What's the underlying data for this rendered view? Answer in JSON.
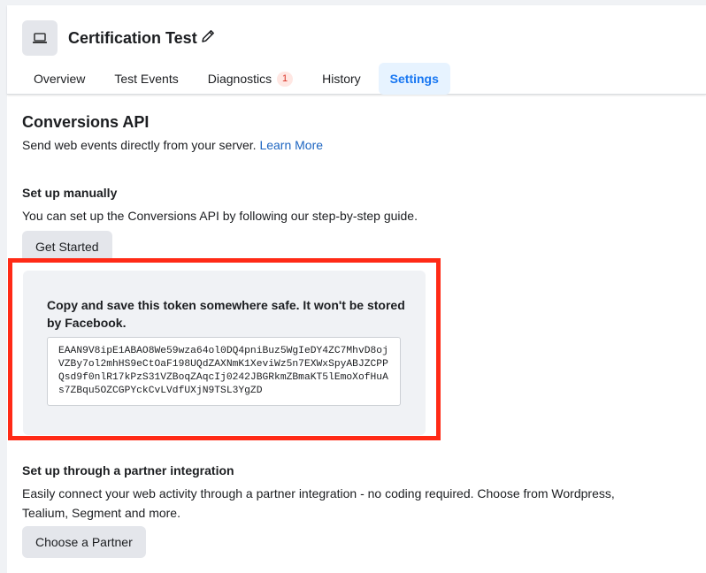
{
  "header": {
    "title": "Certification Test",
    "icons": {
      "app": "laptop-icon",
      "edit": "pencil-icon"
    }
  },
  "tabs": [
    {
      "label": "Overview"
    },
    {
      "label": "Test Events"
    },
    {
      "label": "Diagnostics",
      "badge": "1"
    },
    {
      "label": "History"
    },
    {
      "label": "Settings",
      "active": true
    }
  ],
  "conversions_api": {
    "title": "Conversions API",
    "description": "Send web events directly from your server.",
    "learn_more": "Learn More"
  },
  "manual_setup": {
    "title": "Set up manually",
    "text": "You can set up the Conversions API by following our step-by-step guide.",
    "button": "Get Started"
  },
  "token": {
    "heading": "Copy and save this token somewhere safe. It won't be stored by Facebook.",
    "value": "EAAN9V8ipE1ABAO8We59wza64ol0DQ4pniBuz5WgIeDY4ZC7MhvD8ojVZBy7ol2mhHS9eCtOaF198UQdZAXNmK1XeviWz5n7EXWxSpyABJZCPPQsd9f0nlR17kPzS31VZBoqZAqcIj0242JBGRkmZBmaKT5lEmoXofHuAs7ZBqu5OZCGPYckCvLVdfUXjN9TSL3YgZD"
  },
  "partner": {
    "title": "Set up through a partner integration",
    "text": "Easily connect your web activity through a partner integration - no coding required. Choose from Wordpress, Tealium, Segment and more.",
    "button": "Choose a Partner"
  },
  "colors": {
    "accent": "#1877f2",
    "link": "#1d65c1",
    "highlight": "#ff2a16",
    "badge": "#d93025"
  }
}
